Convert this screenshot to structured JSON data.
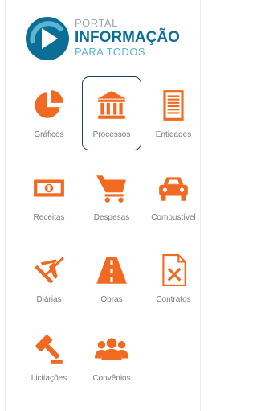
{
  "logo": {
    "line1": "PORTAL",
    "line2": "INFORMAÇÃO",
    "line3": "PARA TODOS",
    "colors": {
      "dark_blue": "#0b6e95",
      "light_blue": "#5bb4d3",
      "gray": "#9ba3ab"
    }
  },
  "accent_color": "#f26a22",
  "selected_border_color": "#1f3c6b",
  "menu": [
    {
      "label": "Gráficos",
      "icon": "pie-chart-icon",
      "selected": false
    },
    {
      "label": "Processos",
      "icon": "bank-building-icon",
      "selected": true
    },
    {
      "label": "Entidades",
      "icon": "document-list-icon",
      "selected": false
    },
    {
      "label": "Receitas",
      "icon": "money-bill-icon",
      "selected": false
    },
    {
      "label": "Despesas",
      "icon": "shopping-cart-icon",
      "selected": false
    },
    {
      "label": "Combustível",
      "icon": "car-icon",
      "selected": false
    },
    {
      "label": "Diárias",
      "icon": "airplane-icon",
      "selected": false
    },
    {
      "label": "Obras",
      "icon": "road-icon",
      "selected": false
    },
    {
      "label": "Contratos",
      "icon": "excel-file-icon",
      "selected": false
    },
    {
      "label": "Licitações",
      "icon": "gavel-icon",
      "selected": false
    },
    {
      "label": "Convênios",
      "icon": "people-group-icon",
      "selected": false
    }
  ]
}
